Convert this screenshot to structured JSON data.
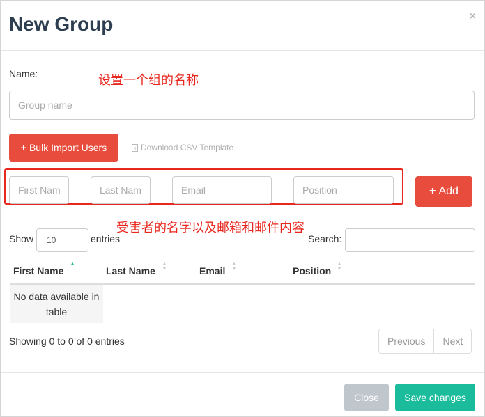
{
  "modal": {
    "title": "New Group",
    "close_symbol": "×"
  },
  "name_field": {
    "label": "Name:",
    "placeholder": "Group name",
    "annotation": "设置一个组的名称"
  },
  "import": {
    "bulk_label": "Bulk Import Users",
    "csv_label": "Download CSV Template",
    "plus_icon": "+"
  },
  "user_inputs": {
    "first_name_placeholder": "First Name",
    "last_name_placeholder": "Last Name",
    "email_placeholder": "Email",
    "position_placeholder": "Position",
    "add_label": "Add",
    "annotation": "受害者的名字以及邮箱和邮件内容"
  },
  "table_controls": {
    "show_label": "Show",
    "entries_value": "10",
    "entries_label": "entries",
    "search_label": "Search:"
  },
  "table": {
    "columns": [
      "First Name",
      "Last Name",
      "Email",
      "Position"
    ],
    "empty_message": "No data available in table",
    "info": "Showing 0 to 0 of 0 entries"
  },
  "pagination": {
    "previous": "Previous",
    "next": "Next"
  },
  "footer": {
    "close_label": "Close",
    "save_label": "Save changes"
  },
  "colors": {
    "danger": "#e74c3c",
    "success": "#1abc9c",
    "annotation": "#e8281e",
    "title": "#2c3e50"
  }
}
